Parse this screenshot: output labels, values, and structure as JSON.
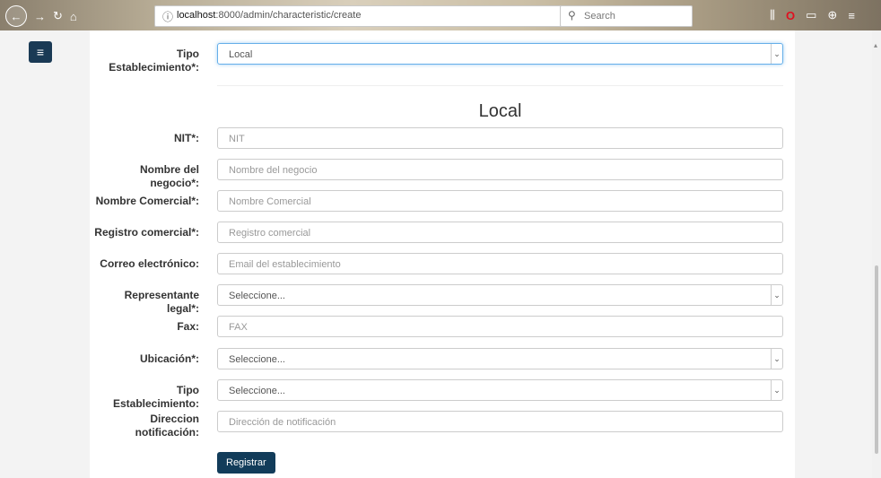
{
  "browser": {
    "url_host": "localhost",
    "url_rest": ":8000/admin/characteristic/create",
    "search_placeholder": "Search",
    "page_actions": "···"
  },
  "form": {
    "tipo_label": "Tipo Establecimiento*:",
    "tipo_value": "Local",
    "section_title": "Local",
    "fields": [
      {
        "label": "NIT*:",
        "placeholder": "NIT",
        "type": "input"
      },
      {
        "label": "Nombre del negocio*:",
        "placeholder": "Nombre del negocio",
        "type": "input"
      },
      {
        "label": "Nombre Comercial*:",
        "placeholder": "Nombre Comercial",
        "type": "input"
      },
      {
        "label": "Registro comercial*:",
        "placeholder": "Registro comercial",
        "type": "input"
      },
      {
        "label": "Correo electrónico:",
        "placeholder": "Email del establecimiento",
        "type": "input"
      },
      {
        "label": "Representante legal*:",
        "value": "Seleccione...",
        "type": "select"
      },
      {
        "label": "Fax:",
        "placeholder": "FAX",
        "type": "input"
      },
      {
        "label": "Ubicación*:",
        "value": "Seleccione...",
        "type": "select"
      },
      {
        "label": "Tipo Establecimiento:",
        "value": "Seleccione...",
        "type": "select"
      },
      {
        "label": "Direccion notificación:",
        "placeholder": "Dirección de notificación",
        "type": "input"
      }
    ],
    "submit_label": "Registrar"
  },
  "colors": {
    "primary": "#123c5a",
    "focus_border": "#66afe9"
  }
}
